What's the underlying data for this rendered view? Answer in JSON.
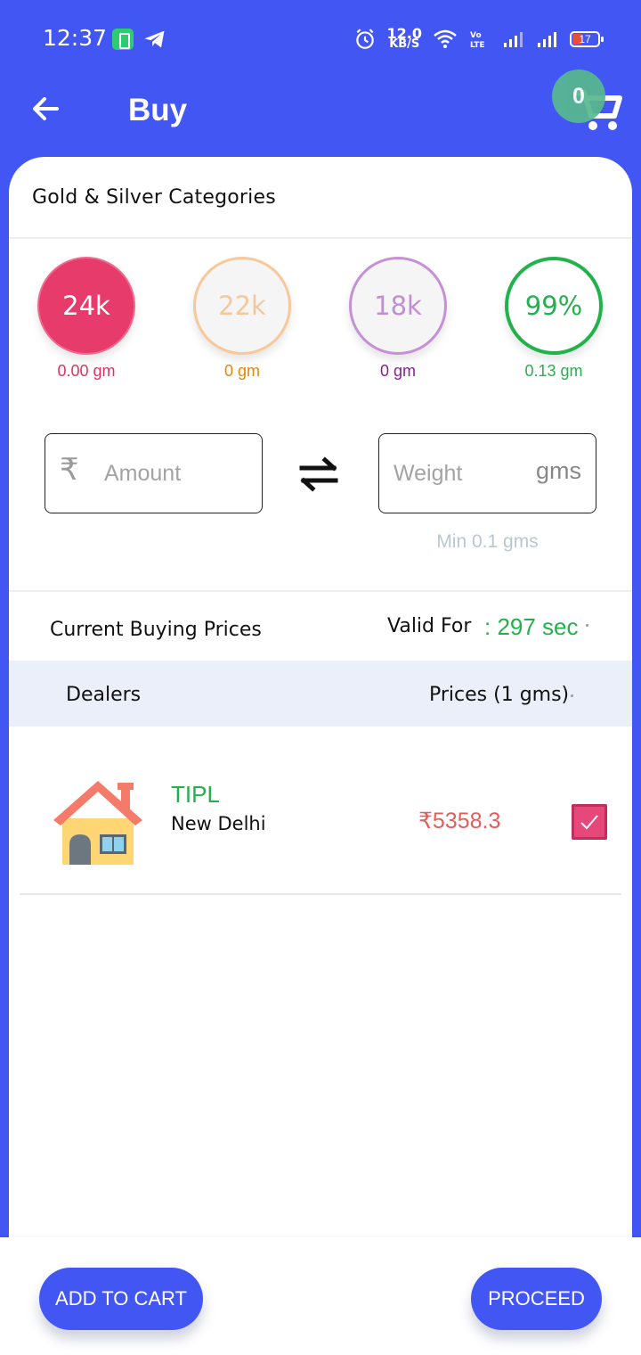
{
  "status_bar": {
    "time": "12:37",
    "net_speed_value": "12.0",
    "net_speed_unit": "KB/S",
    "battery": "17"
  },
  "header": {
    "title": "Buy",
    "cart_count": "0"
  },
  "categories": {
    "title": "Gold & Silver Categories",
    "items": [
      {
        "label": "24k",
        "qty": "0.00 gm",
        "color": "#e73b6b"
      },
      {
        "label": "22k",
        "qty": "0 gm",
        "color": "#f6c89a"
      },
      {
        "label": "18k",
        "qty": "0 gm",
        "color": "#c591d6"
      },
      {
        "label": "99%",
        "qty": "0.13 gm",
        "color": "#22b24c"
      }
    ]
  },
  "inputs": {
    "currency_symbol": "₹",
    "amount_placeholder": "Amount",
    "weight_placeholder": "Weight",
    "weight_unit": "gms",
    "min_hint": "Min 0.1 gms"
  },
  "prices": {
    "title": "Current Buying Prices",
    "valid_label": "Valid For",
    "valid_value": ": 297 sec"
  },
  "table": {
    "col_dealers": "Dealers",
    "col_prices": "Prices (1 gms)",
    "rows": [
      {
        "name": "TIPL",
        "city": "New Delhi",
        "price": "₹5358.3",
        "selected": true
      }
    ]
  },
  "actions": {
    "add_to_cart": "ADD TO CART",
    "proceed": "PROCEED"
  },
  "colors": {
    "primary": "#4256f4",
    "accent_green": "#22b24c",
    "price_red": "#e35d5d",
    "checkbox": "#e6487a"
  }
}
